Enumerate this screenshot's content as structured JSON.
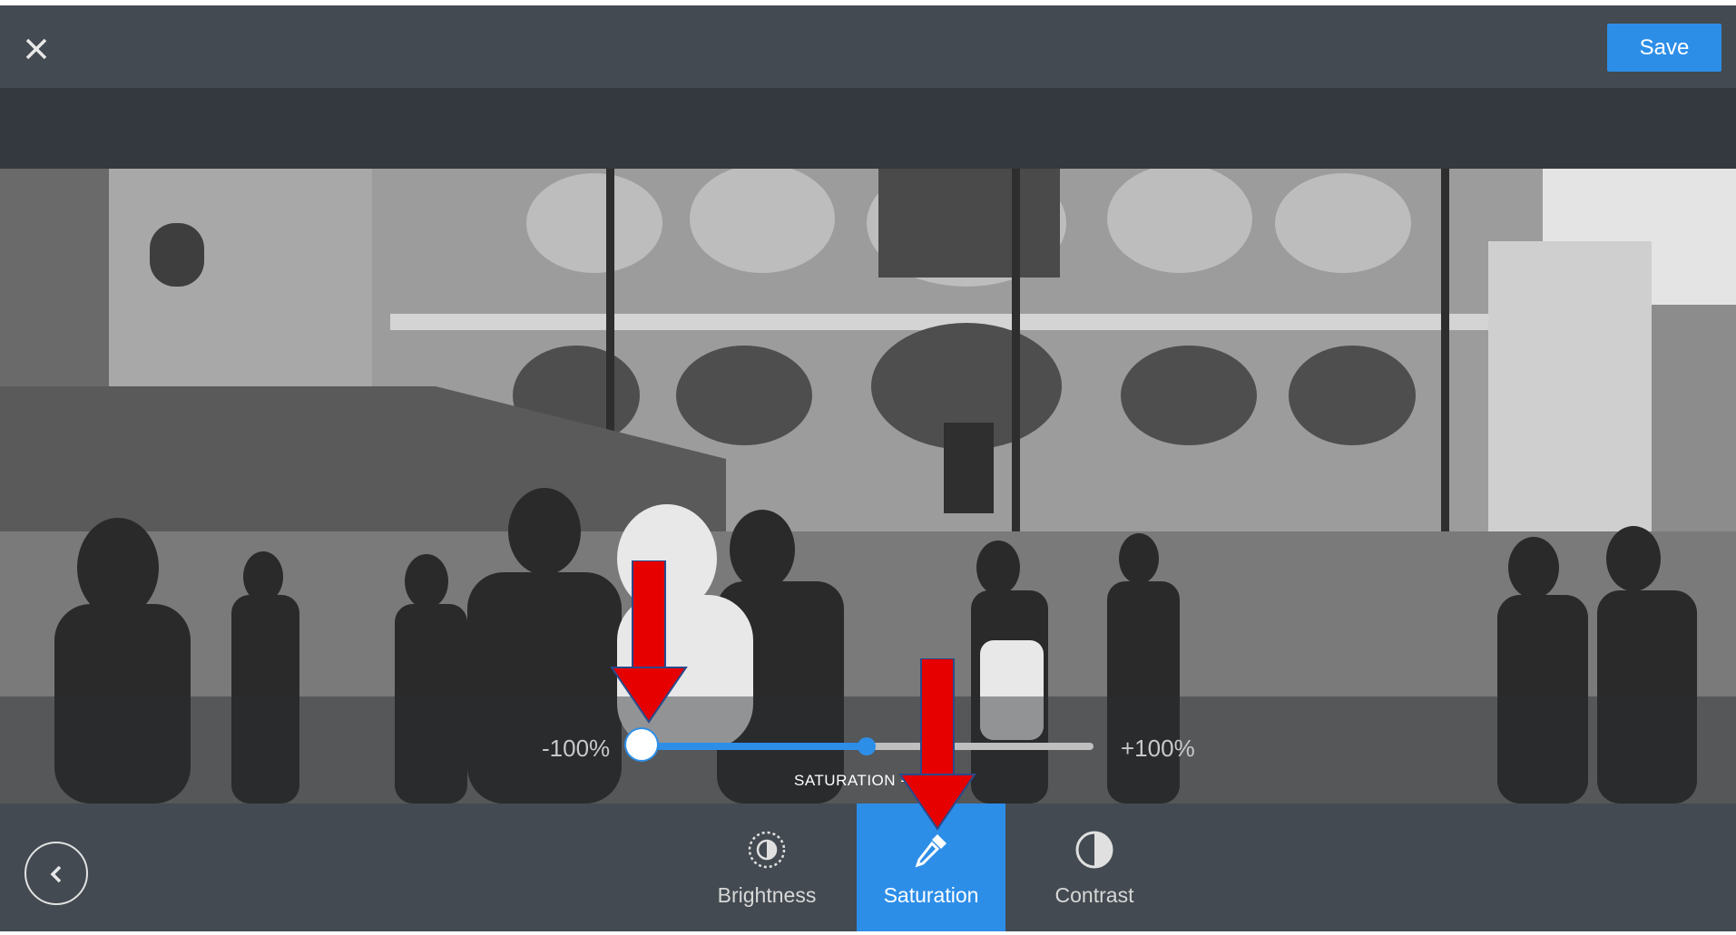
{
  "header": {
    "close_icon": "close-icon",
    "save_label": "Save"
  },
  "slider": {
    "min_label": "-100%",
    "max_label": "+100%",
    "caption": "SATURATION -1",
    "value_fraction": 0.0
  },
  "toolbar": {
    "back_icon": "chevron-left-icon",
    "tools": [
      {
        "label": "Brightness",
        "icon": "brightness-icon",
        "active": false
      },
      {
        "label": "Saturation",
        "icon": "eyedropper-icon",
        "active": true
      },
      {
        "label": "Contrast",
        "icon": "contrast-icon",
        "active": false
      }
    ]
  },
  "annotations": {
    "arrow_color": "#e60000"
  },
  "colors": {
    "accent": "#2d8ee8",
    "bar": "#434a51",
    "canvas": "#33393f"
  }
}
